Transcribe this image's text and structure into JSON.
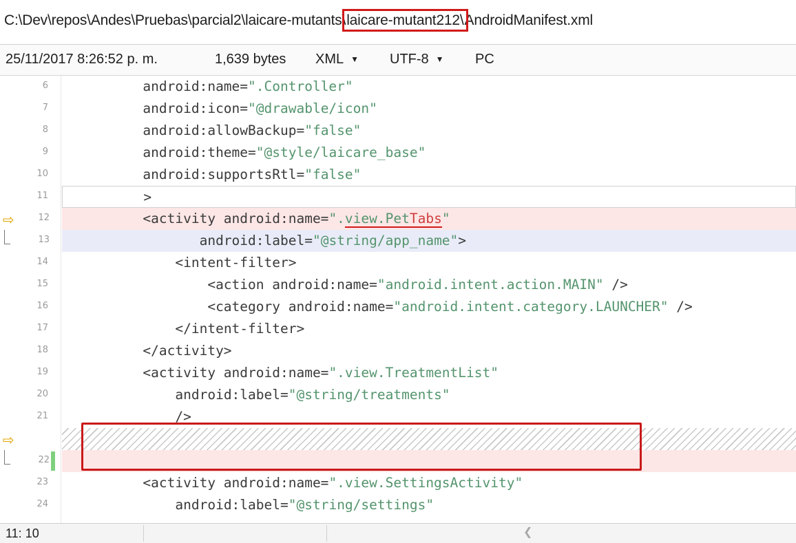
{
  "path": {
    "prefix": "C:\\Dev\\repos\\Andes\\Pruebas\\parcial2\\laicare-mutants\\",
    "highlight": "laicare-mutant212\\",
    "suffix": "AndroidManifest.xml"
  },
  "info": {
    "timestamp": "25/11/2017 8:26:52 p. m.",
    "size": "1,639 bytes",
    "format": "XML",
    "encoding": "UTF-8",
    "line_endings": "PC"
  },
  "lines": {
    "l6": {
      "num": "6",
      "a": "android:name=",
      "b": "\".Controller\""
    },
    "l7": {
      "num": "7",
      "a": "android:icon=",
      "b": "\"@drawable/icon\""
    },
    "l8": {
      "num": "8",
      "a": "android:allowBackup=",
      "b": "\"false\""
    },
    "l9": {
      "num": "9",
      "a": "android:theme=",
      "b": "\"@style/laicare_base\""
    },
    "l10": {
      "num": "10",
      "a": "android:supportsRtl=",
      "b": "\"false\""
    },
    "l11": {
      "num": "11",
      "a": ">"
    },
    "l12": {
      "num": "12",
      "a": "<activity android:name=",
      "b": "\".",
      "c": "view.Pet",
      "d": "Tabs",
      "e": "\""
    },
    "l13": {
      "num": "13",
      "a": "android:label=",
      "b": "\"@string/app_name\"",
      "c": ">"
    },
    "l14": {
      "num": "14",
      "a": "<intent-filter>"
    },
    "l15": {
      "num": "15",
      "a": "<action android:name=",
      "b": "\"android.intent.action.MAIN\"",
      "c": " />"
    },
    "l16": {
      "num": "16",
      "a": "<category android:name=",
      "b": "\"android.intent.category.LAUNCHER\"",
      "c": " />"
    },
    "l17": {
      "num": "17",
      "a": "</intent-filter>"
    },
    "l18": {
      "num": "18",
      "a": "</activity>"
    },
    "l19": {
      "num": "19",
      "a": "<activity android:name=",
      "b": "\".view.TreatmentList\""
    },
    "l20": {
      "num": "20",
      "a": "android:label=",
      "b": "\"@string/treatments\""
    },
    "l21": {
      "num": "21",
      "a": "/>"
    },
    "l22": {
      "num": "22"
    },
    "l23": {
      "num": "23",
      "a": "<activity android:name=",
      "b": "\".view.SettingsActivity\""
    },
    "l24": {
      "num": "24",
      "a": "android:label=",
      "b": "\"@string/settings\""
    }
  },
  "status": {
    "cursor": "11: 10"
  }
}
